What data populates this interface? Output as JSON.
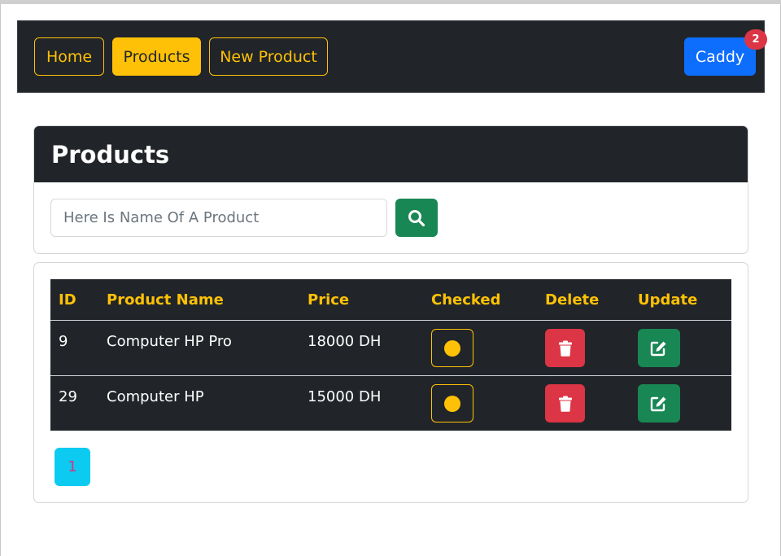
{
  "nav": {
    "home_label": "Home",
    "products_label": "Products",
    "new_product_label": "New Product",
    "caddy_label": "Caddy",
    "caddy_count": "2"
  },
  "search_card": {
    "title": "Products",
    "placeholder": "Here Is Name Of A Product",
    "search_icon": "search-icon"
  },
  "table": {
    "headers": {
      "id": "ID",
      "name": "Product Name",
      "price": "Price",
      "checked": "Checked",
      "delete": "Delete",
      "update": "Update"
    },
    "rows": [
      {
        "id": "9",
        "name": "Computer HP Pro",
        "price": "18000 DH"
      },
      {
        "id": "29",
        "name": "Computer HP",
        "price": "15000 DH"
      }
    ]
  },
  "pagination": {
    "current_page": "1"
  },
  "colors": {
    "dark": "#212529",
    "warning": "#ffc107",
    "primary": "#0d6efd",
    "danger": "#dc3545",
    "success": "#198754",
    "info": "#0dcaf0"
  }
}
